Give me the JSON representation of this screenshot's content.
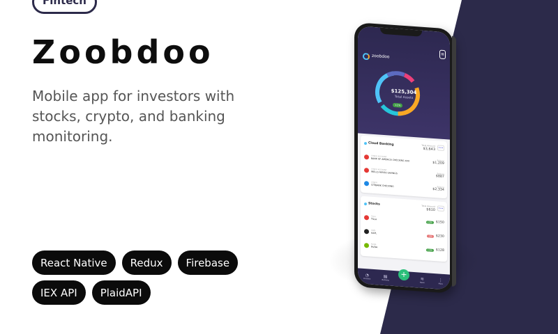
{
  "category": "Fintech",
  "title": "Zoobdoo",
  "description": "Mobile app for investors with stocks, crypto, and banking monitoring.",
  "tags": [
    "React Native",
    "Redux",
    "Firebase",
    "IEX API",
    "PlaidAPI"
  ],
  "colors": {
    "panel": "#2c2a4a",
    "tag_bg": "#0b0b0b",
    "accent_green": "#2bbf7a"
  },
  "phone": {
    "app_name": "zoobdoo",
    "total_value": "$125,304",
    "total_label": "Total Assets",
    "change_badge": "+1%",
    "banking": {
      "title": "Cloud Banking",
      "total_label": "Total Amount",
      "total": "$3,643",
      "rows": [
        {
          "sub": "CHECK ACCOUNT",
          "name": "BANK OF AMERICA CHECKING XXX",
          "val_label": "Balance",
          "val": "$1,209",
          "color": "#e53935"
        },
        {
          "sub": "CHECK ACCOUNT",
          "name": "WELLS FARGO SAVINGS",
          "val_label": "Balance",
          "val": "$887",
          "color": "#e53935"
        },
        {
          "sub": "CHECK",
          "name": "CITIBANK CHECKING",
          "val_label": "Balance",
          "val": "$2,334",
          "color": "#1e88e5"
        }
      ]
    },
    "stocks": {
      "title": "Stocks",
      "total_label": "Total Amount",
      "total": "$610",
      "rows": [
        {
          "sub": "TSLA",
          "name": "TSLA",
          "chg": "+2%",
          "chg_color": "#43a047",
          "val": "$150",
          "color": "#e53935"
        },
        {
          "sub": "AAPL",
          "name": "AAPL",
          "chg": "-1%",
          "chg_color": "#e57373",
          "val": "$230",
          "color": "#222222"
        },
        {
          "sub": "NVDA",
          "name": "NVDA",
          "chg": "+1%",
          "chg_color": "#43a047",
          "val": "$128",
          "color": "#76b900"
        }
      ]
    },
    "nav": [
      {
        "glyph": "◔",
        "label": "Portfolio"
      },
      {
        "glyph": "▤",
        "label": "Banking"
      },
      {
        "glyph": "+",
        "label": ""
      },
      {
        "glyph": "≋",
        "label": "News"
      },
      {
        "glyph": "⋮",
        "label": "More"
      }
    ]
  }
}
